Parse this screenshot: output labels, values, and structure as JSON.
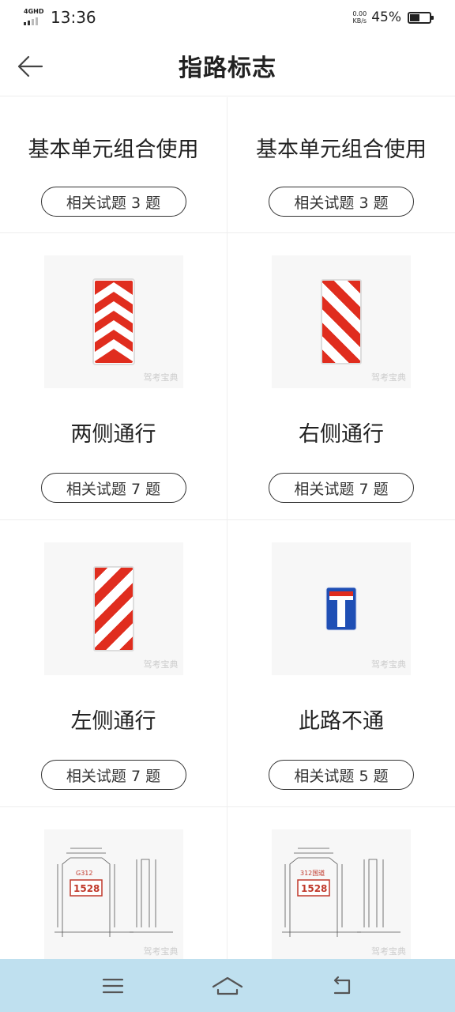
{
  "status_bar": {
    "network": "4GHD",
    "time": "13:36",
    "net_speed_value": "0.00",
    "net_speed_unit": "KB/s",
    "battery_percent": "45%",
    "battery_level": 0.45
  },
  "header": {
    "title": "指路标志",
    "back_icon": "arrow-left-icon"
  },
  "items": [
    {
      "name": "基本单元组合使用",
      "related": "相关试题 3 题",
      "image": null
    },
    {
      "name": "基本单元组合使用",
      "related": "相关试题 3 题",
      "image": null
    },
    {
      "name": "两侧通行",
      "related": "相关试题 7 题",
      "image": "chevron-both",
      "watermark": "驾考宝典"
    },
    {
      "name": "右侧通行",
      "related": "相关试题 7 题",
      "image": "stripe-right",
      "watermark": "驾考宝典"
    },
    {
      "name": "左侧通行",
      "related": "相关试题 7 题",
      "image": "stripe-left",
      "watermark": "驾考宝典"
    },
    {
      "name": "此路不通",
      "related": "相关试题 5 题",
      "image": "dead-end",
      "watermark": "驾考宝典"
    },
    {
      "image": "milestone-plan-g312",
      "plate_top": "G312",
      "plate_number": "1528",
      "watermark": "驾考宝典"
    },
    {
      "image": "milestone-plan-312",
      "plate_top": "312国道",
      "plate_number": "1528",
      "watermark": "驾考宝典"
    }
  ],
  "nav_bar": {
    "menu_icon": "menu-icon",
    "home_icon": "home-icon",
    "back_icon": "back-icon"
  },
  "colors": {
    "sign_red": "#e02d1e",
    "sign_blue": "#1f4fb5",
    "nav_bar_bg": "#bfe0ef"
  }
}
